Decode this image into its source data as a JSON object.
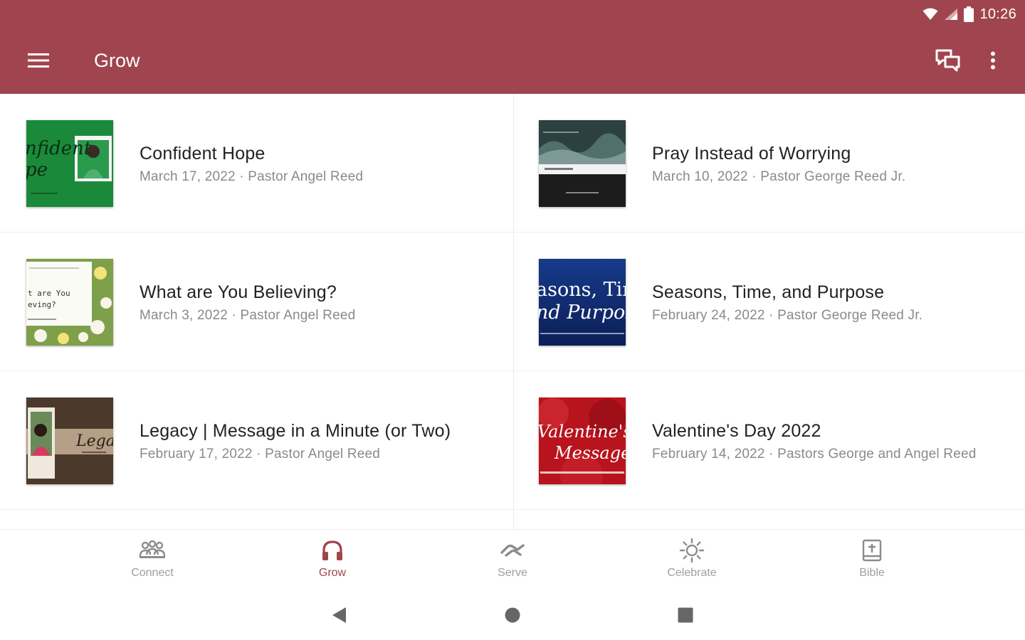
{
  "status_bar": {
    "time": "10:26"
  },
  "app_bar": {
    "title": "Grow",
    "background": "#a0454f"
  },
  "sermons": [
    {
      "title": "Confident Hope",
      "meta": "March 17, 2022 · Pastor Angel Reed",
      "thumb_text": [
        "nfident",
        "pe"
      ]
    },
    {
      "title": "Pray Instead of Worrying",
      "meta": "March 10, 2022 · Pastor George Reed Jr.",
      "thumb_text": []
    },
    {
      "title": "What are You Believing?",
      "meta": "March 3, 2022 · Pastor Angel Reed",
      "thumb_text": [
        "t are You",
        "eving?"
      ]
    },
    {
      "title": "Seasons, Time, and Purpose",
      "meta": "February 24, 2022 · Pastor George Reed Jr.",
      "thumb_text": [
        "asons, Tim",
        "nd Purpos"
      ]
    },
    {
      "title": "Legacy | Message in a Minute (or Two)",
      "meta": "February 17, 2022 · Pastor Angel Reed",
      "thumb_text": [
        "Legac"
      ]
    },
    {
      "title": "Valentine's Day 2022",
      "meta": "February 14, 2022 · Pastors George and Angel Reed",
      "thumb_text": [
        "Valentine's D",
        "Message"
      ]
    }
  ],
  "bottom_nav": {
    "active": "Grow",
    "accent": "#a0454f",
    "items": [
      {
        "label": "Connect",
        "icon": "people-icon"
      },
      {
        "label": "Grow",
        "icon": "headphones-icon"
      },
      {
        "label": "Serve",
        "icon": "handshake-icon"
      },
      {
        "label": "Celebrate",
        "icon": "sun-icon"
      },
      {
        "label": "Bible",
        "icon": "bible-icon"
      }
    ]
  },
  "system_nav": {
    "buttons": [
      "back",
      "home",
      "recents"
    ]
  }
}
